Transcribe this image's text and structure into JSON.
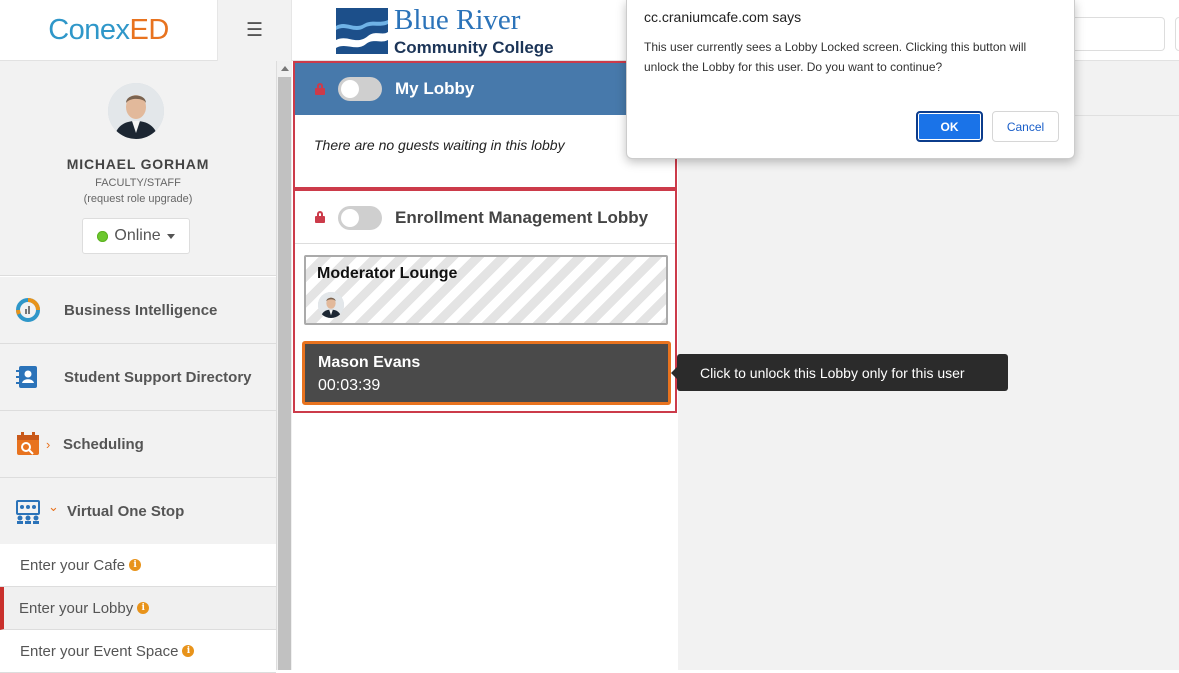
{
  "header": {
    "logo": {
      "part1": "Conex",
      "part2": "ED"
    },
    "menu_icon": "hamburger-icon",
    "college": {
      "name": "Blue River",
      "subtitle": "Community College"
    }
  },
  "sidebar": {
    "profile": {
      "name": "MICHAEL GORHAM",
      "role": "FACULTY/STAFF",
      "upgrade": "(request role upgrade)",
      "status": "Online"
    },
    "items": [
      {
        "label": "Business Intelligence",
        "icon": "chart-ring-icon"
      },
      {
        "label": "Student Support Directory",
        "icon": "directory-book-icon"
      },
      {
        "label": "Scheduling",
        "icon": "calendar-search-icon",
        "expander": "›"
      },
      {
        "label": "Virtual One Stop",
        "icon": "group-screen-icon",
        "expander": "⌄"
      }
    ],
    "subitems": [
      {
        "label": "Enter your Cafe",
        "info": "i"
      },
      {
        "label": "Enter your Lobby",
        "info": "i",
        "active": true
      },
      {
        "label": "Enter your Event Space",
        "info": "i"
      }
    ]
  },
  "lobbies": {
    "my_lobby": {
      "title": "My Lobby",
      "empty_message": "There are no guests waiting in this lobby"
    },
    "enrollment": {
      "title": "Enrollment Management Lobby",
      "moderator_title": "Moderator Lounge",
      "guest": {
        "name": "Mason Evans",
        "timer": "00:03:39"
      }
    }
  },
  "tooltip": {
    "text": "Click to unlock this Lobby only for this user"
  },
  "dialog": {
    "origin": "cc.craniumcafe.com says",
    "message": "This user currently sees a Lobby Locked screen.  Clicking this button will unlock the Lobby for this user.  Do you want to continue?",
    "ok_label": "OK",
    "cancel_label": "Cancel"
  },
  "colors": {
    "accent_blue": "#4779ab",
    "lock_red": "#cc3b4a",
    "guest_highlight": "#e8731f",
    "status_online": "#6cc72e"
  }
}
